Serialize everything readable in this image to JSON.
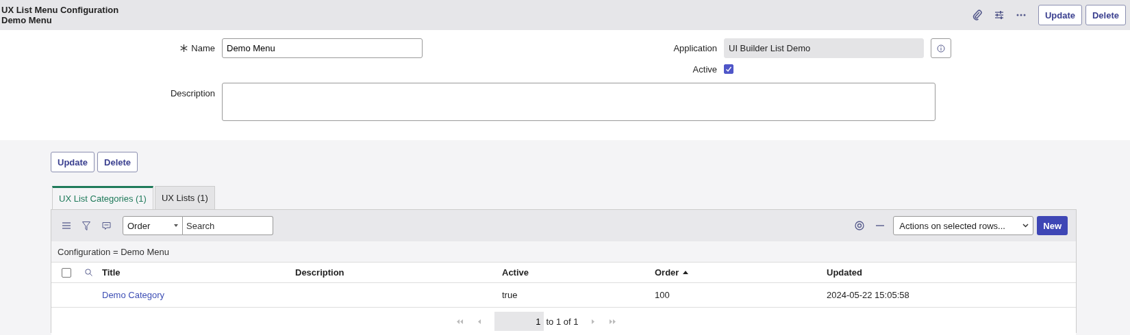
{
  "header": {
    "title": "UX List Menu Configuration",
    "subtitle": "Demo Menu",
    "buttons": [
      "Update",
      "Delete"
    ]
  },
  "form": {
    "name": {
      "label": "Name",
      "value": "Demo Menu",
      "required": true
    },
    "application": {
      "label": "Application",
      "value": "UI Builder List Demo"
    },
    "active": {
      "label": "Active",
      "checked": true
    },
    "description": {
      "label": "Description"
    }
  },
  "buttons": [
    "Update",
    "Delete"
  ],
  "tabs": [
    {
      "label": "UX List Categories (1)",
      "selected": true
    },
    {
      "label": "UX Lists (1)",
      "selected": false
    }
  ],
  "list": {
    "search_field": {
      "value": "Order"
    },
    "search": {
      "placeholder": "Search"
    },
    "actions": {
      "value": "Actions on selected rows..."
    },
    "new_button": "New",
    "breadcrumb": "Configuration = Demo Menu",
    "select_all": {
      "checked": false
    },
    "columns": [
      {
        "label": "Title",
        "sorted": false
      },
      {
        "label": "Description",
        "sorted": false
      },
      {
        "label": "Active",
        "sorted": false
      },
      {
        "label": "Order",
        "sorted": true
      },
      {
        "label": "Updated",
        "sorted": false
      }
    ],
    "rows": [
      {
        "selected": false,
        "cells": [
          "Demo Category",
          "",
          "true",
          "100",
          "2024-05-22 15:05:58"
        ]
      }
    ],
    "pagination": {
      "page": "1",
      "range": "to 1 of 1"
    }
  }
}
